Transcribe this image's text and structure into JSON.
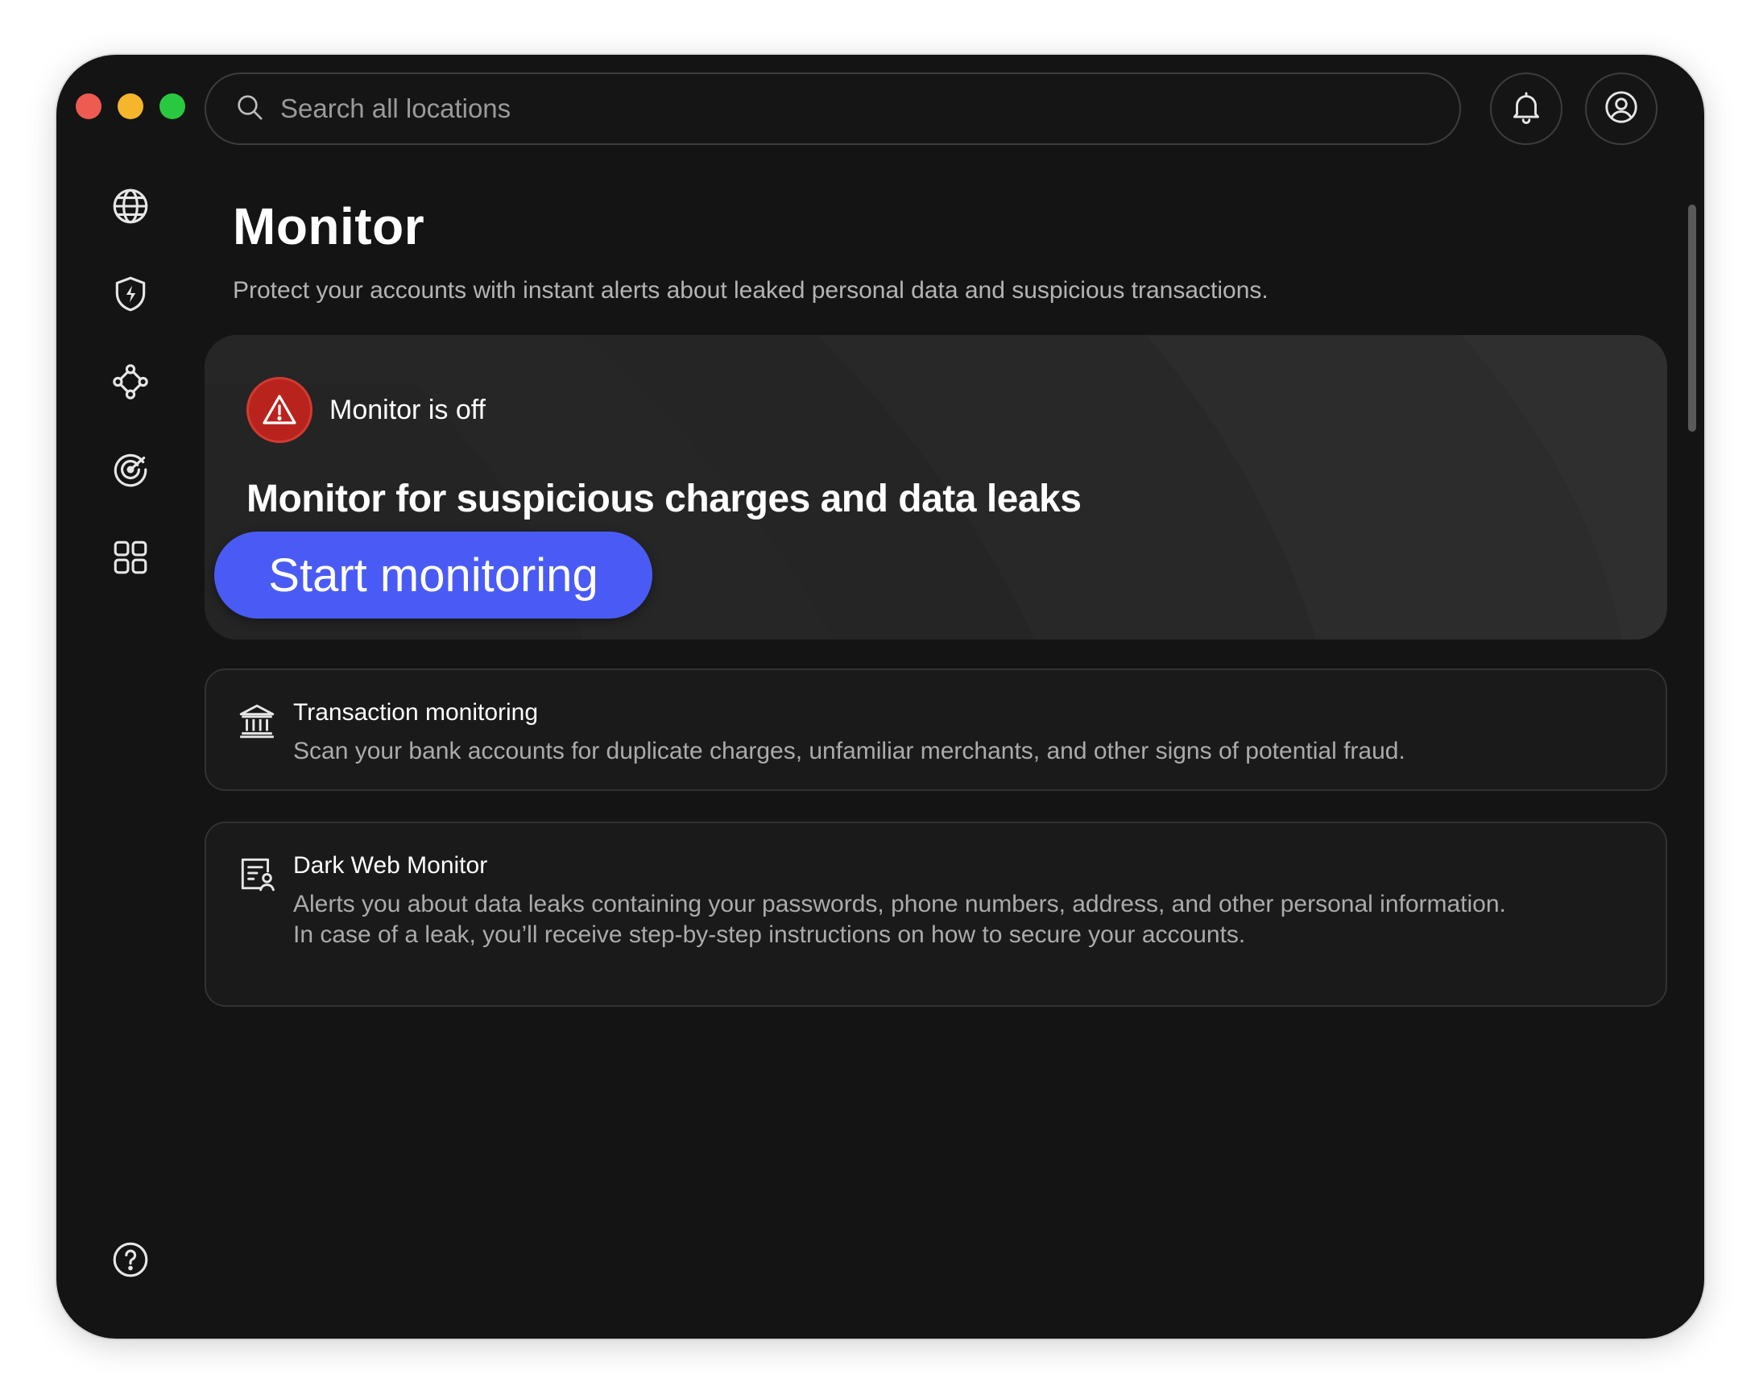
{
  "search": {
    "placeholder": "Search all locations"
  },
  "header": {
    "notifications_icon": "bell-icon",
    "account_icon": "user-circle-icon"
  },
  "sidebar": {
    "items": [
      {
        "icon": "globe-icon"
      },
      {
        "icon": "shield-bolt-icon"
      },
      {
        "icon": "network-nodes-icon"
      },
      {
        "icon": "radar-target-icon"
      },
      {
        "icon": "apps-grid-icon"
      }
    ],
    "help_icon": "question-circle-icon"
  },
  "main": {
    "title": "Monitor",
    "subtitle": "Protect your accounts with instant alerts about leaked personal data and suspicious transactions.",
    "hero": {
      "status": "Monitor is off",
      "heading": "Monitor for suspicious charges and data leaks",
      "button": "Start monitoring"
    },
    "features": [
      {
        "icon": "bank-icon",
        "title": "Transaction monitoring",
        "description": [
          "Scan your bank accounts for duplicate charges, unfamiliar merchants, and other signs of potential fraud."
        ]
      },
      {
        "icon": "identity-document-icon",
        "title": "Dark Web Monitor",
        "description": [
          "Alerts you about data leaks containing your passwords, phone numbers, address, and other personal information.",
          "In case of a leak, you’ll receive step-by-step instructions on how to secure your accounts."
        ]
      }
    ]
  },
  "colors": {
    "window_bg": "#141414",
    "accent": "#4a5bf5",
    "alert_red": "#b8241d",
    "card_bg": "#2a2a2a"
  }
}
